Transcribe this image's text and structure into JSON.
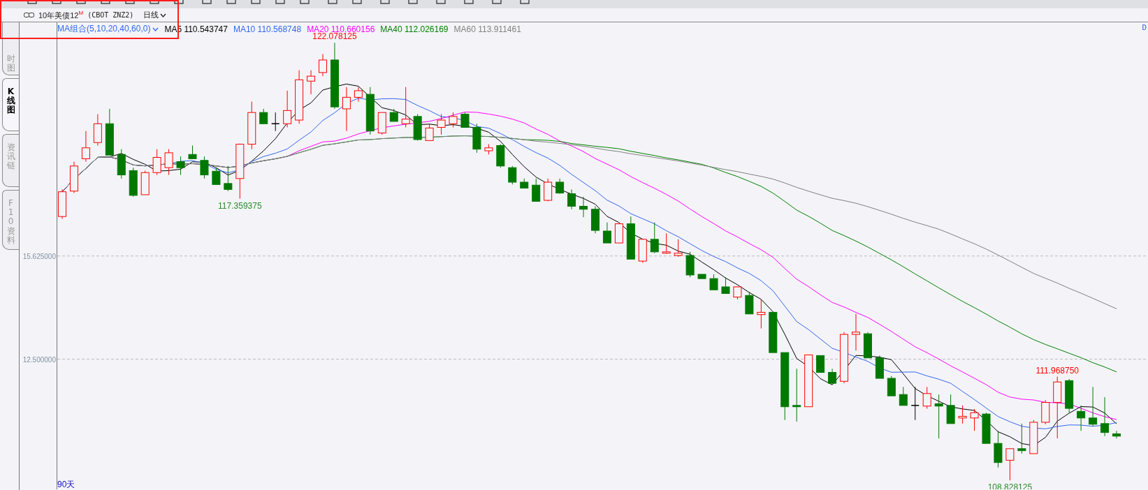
{
  "symbol_bar": {
    "name": "10年美债12$^{M}$",
    "code": "(CBOT ZNZ2)",
    "period": "日线"
  },
  "side_tabs": [
    {
      "label": "时图",
      "selected": false
    },
    {
      "label": "K线图",
      "selected": true
    },
    {
      "label": "资讯链",
      "selected": false
    },
    {
      "label": "F10资料",
      "selected": false
    }
  ],
  "chart": {
    "indicator": "MA组合(5,10,20,40,60,0)",
    "legend": [
      {
        "label": "MA5 110.543747",
        "color": "#000000"
      },
      {
        "label": "MA10 110.568748",
        "color": "#3366ee"
      },
      {
        "label": "MA20 110.660156",
        "color": "#ff00ff"
      },
      {
        "label": "MA40 112.026169",
        "color": "#008000"
      },
      {
        "label": "MA60 113.911461",
        "color": "#808080"
      }
    ],
    "corner_mark": "D",
    "period_label": "90天",
    "price_axis_labels": [
      "15.625000",
      "12.500000"
    ],
    "extreme_labels": [
      {
        "label": "122.078125",
        "kind": "high"
      },
      {
        "label": "117.359375",
        "kind": "low"
      },
      {
        "label": "111.968750",
        "kind": "high"
      },
      {
        "label": "108.828125",
        "kind": "low"
      }
    ]
  }
}
